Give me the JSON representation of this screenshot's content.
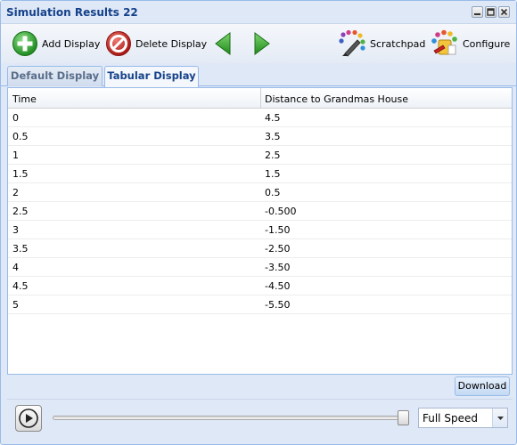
{
  "window": {
    "title": "Simulation Results 22"
  },
  "toolbar": {
    "add_display": "Add Display",
    "delete_display": "Delete Display",
    "scratchpad": "Scratchpad",
    "configure": "Configure"
  },
  "tabs": [
    {
      "label": "Default Display",
      "active": false
    },
    {
      "label": "Tabular Display",
      "active": true
    }
  ],
  "table": {
    "columns": [
      "Time",
      "Distance to Grandmas House"
    ],
    "rows": [
      [
        "0",
        "4.5"
      ],
      [
        "0.5",
        "3.5"
      ],
      [
        "1",
        "2.5"
      ],
      [
        "1.5",
        "1.5"
      ],
      [
        "2",
        "0.5"
      ],
      [
        "2.5",
        "-0.500"
      ],
      [
        "3",
        "-1.50"
      ],
      [
        "3.5",
        "-2.50"
      ],
      [
        "4",
        "-3.50"
      ],
      [
        "4.5",
        "-4.50"
      ],
      [
        "5",
        "-5.50"
      ]
    ]
  },
  "footer": {
    "download": "Download"
  },
  "player": {
    "speed": "Full Speed",
    "progress": 1.0
  },
  "colors": {
    "accent": "#15428b",
    "panel": "#dfe8f6",
    "border": "#99bbe8",
    "add_green": "#2ea12e",
    "delete_red": "#c8221e",
    "arrow_green": "#33a52b"
  },
  "icons": [
    "add-icon",
    "delete-icon",
    "back-arrow-icon",
    "forward-arrow-icon",
    "scratchpad-icon",
    "configure-icon",
    "play-icon",
    "dropdown-arrow-icon"
  ]
}
